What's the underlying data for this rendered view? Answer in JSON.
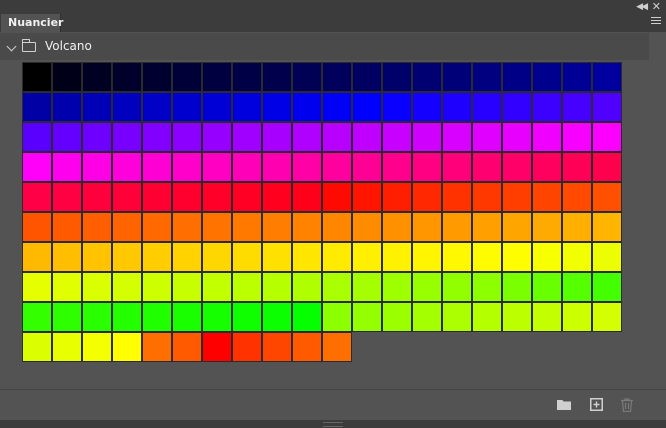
{
  "panel": {
    "tab_label": "Nuancier",
    "group_name": "Volcano"
  },
  "swatches": [
    [
      "#000000",
      "#000018",
      "#000022",
      "#00002a",
      "#000030",
      "#000038",
      "#000040",
      "#000046",
      "#00004d",
      "#000055",
      "#00005c",
      "#000063",
      "#00006a",
      "#000072",
      "#000079",
      "#000080",
      "#000087",
      "#00008f",
      "#000096",
      "#00009e"
    ],
    [
      "#0000a5",
      "#0000ad",
      "#0000b6",
      "#0000be",
      "#0000c6",
      "#0000ce",
      "#0000d6",
      "#0000de",
      "#0000e6",
      "#0000ef",
      "#0000f7",
      "#0000ff",
      "#0a00ff",
      "#1400ff",
      "#1e00ff",
      "#2800ff",
      "#3200ff",
      "#3c00ff",
      "#4600ff",
      "#5000ff"
    ],
    [
      "#5a00ff",
      "#6400ff",
      "#6e00ff",
      "#7800ff",
      "#8200ff",
      "#8c00ff",
      "#9600ff",
      "#a000ff",
      "#a800ff",
      "#b000ff",
      "#b800ff",
      "#c000ff",
      "#c800ff",
      "#d000ff",
      "#d800ff",
      "#e000ff",
      "#e800ff",
      "#f000ff",
      "#f600ff",
      "#fc00ff"
    ],
    [
      "#ff00f8",
      "#ff00ef",
      "#ff00e6",
      "#ff00dd",
      "#ff00d4",
      "#ff00cb",
      "#ff00c2",
      "#ff00b9",
      "#ff00b0",
      "#ff00a7",
      "#ff009e",
      "#ff0095",
      "#ff008c",
      "#ff0083",
      "#ff007a",
      "#ff0071",
      "#ff0068",
      "#ff005f",
      "#ff0056",
      "#ff004d"
    ],
    [
      "#ff0047",
      "#ff0042",
      "#ff003d",
      "#ff0038",
      "#ff0033",
      "#ff002e",
      "#ff0029",
      "#ff0024",
      "#ff001f",
      "#ff001a",
      "#ff0a00",
      "#ff1400",
      "#ff1e00",
      "#ff2800",
      "#ff3200",
      "#ff3800",
      "#ff3e00",
      "#ff4400",
      "#ff4a00",
      "#ff5000"
    ],
    [
      "#ff5500",
      "#ff5a00",
      "#ff5f00",
      "#ff6400",
      "#ff6900",
      "#ff6e00",
      "#ff7300",
      "#ff7800",
      "#ff7d00",
      "#ff8200",
      "#ff8700",
      "#ff8c00",
      "#ff9100",
      "#ff9600",
      "#ff9b00",
      "#ffa000",
      "#ffa500",
      "#ffaa00",
      "#ffaf00",
      "#ffb400"
    ],
    [
      "#ffb900",
      "#ffbe00",
      "#ffc300",
      "#ffc800",
      "#ffcd00",
      "#ffd200",
      "#ffd700",
      "#ffdc00",
      "#ffe100",
      "#ffe600",
      "#ffeb00",
      "#ffef00",
      "#fff200",
      "#fff500",
      "#fff800",
      "#fffb00",
      "#fffe00",
      "#f8ff00",
      "#f2ff00",
      "#ecff00"
    ],
    [
      "#e6ff00",
      "#e0ff00",
      "#daff00",
      "#d4ff00",
      "#ceff00",
      "#c8ff00",
      "#c2ff00",
      "#bcff00",
      "#b6ff00",
      "#b0ff00",
      "#aaff00",
      "#a4ff00",
      "#9eff00",
      "#98ff00",
      "#92ff00",
      "#8cff00",
      "#7aff00",
      "#68ff00",
      "#56ff00",
      "#44ff00"
    ],
    [
      "#33ff00",
      "#2eff00",
      "#29ff00",
      "#24ff00",
      "#1fff00",
      "#1aff00",
      "#15ff00",
      "#10ff00",
      "#0bff00",
      "#06ff00",
      "#8cff00",
      "#94ff00",
      "#9cff00",
      "#a4ff00",
      "#acff00",
      "#b4ff00",
      "#bcff00",
      "#c4ff00",
      "#ccff00",
      "#d4ff00"
    ],
    [
      "#dcff00",
      "#e8ff00",
      "#f4ff00",
      "#ffff00",
      "#ff6e00",
      "#ff5a00",
      "#ff0000",
      "#ff3200",
      "#ff4600",
      "#ff5a00",
      "#ff6e00"
    ]
  ]
}
